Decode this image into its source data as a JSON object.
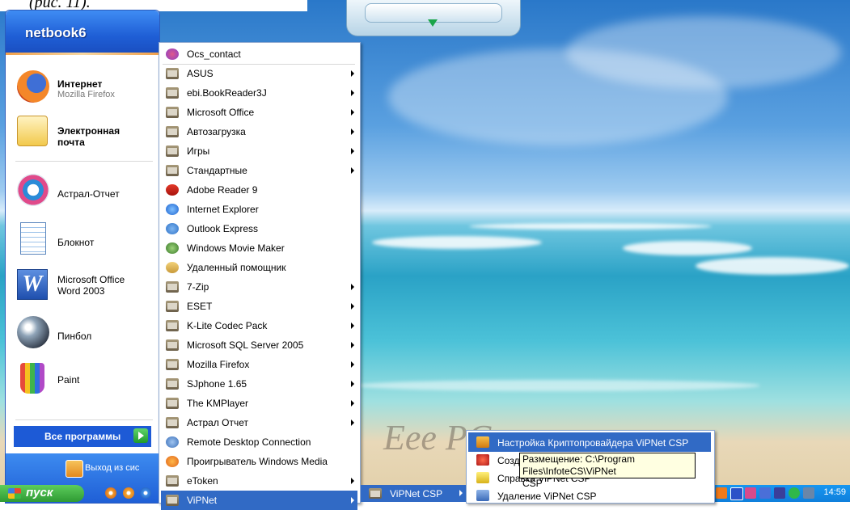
{
  "desktop": {
    "caption": "(рис. 11).",
    "wallpaper_logo": "Eee PC"
  },
  "start_menu": {
    "user": "netbook6",
    "pinned": [
      {
        "title": "Интернет",
        "subtitle": "Mozilla Firefox",
        "icon": "firefox-icon"
      },
      {
        "title": "Электронная",
        "subtitle": "почта",
        "icon": "email-icon"
      }
    ],
    "recent": [
      {
        "title": "Астрал-Отчет",
        "icon": "astral-icon"
      },
      {
        "title": "Блокнот",
        "icon": "notepad-icon"
      },
      {
        "title": "Microsoft Office",
        "subtitle": "Word 2003",
        "icon": "word-icon"
      },
      {
        "title": "Пинбол",
        "icon": "pinball-icon"
      },
      {
        "title": "Paint",
        "icon": "paint-icon"
      }
    ],
    "all_programs": "Все программы",
    "logoff": "Выход из сис"
  },
  "taskbar": {
    "start_label": "пуск",
    "clock": "14:59"
  },
  "programs_menu": {
    "items": [
      {
        "label": "Ocs_contact",
        "icon": "contact-icon",
        "submenu": false
      },
      {
        "label": "ASUS",
        "icon": "folder-icon",
        "submenu": true
      },
      {
        "label": "ebi.BookReader3J",
        "icon": "folder-icon",
        "submenu": true
      },
      {
        "label": "Microsoft Office",
        "icon": "folder-icon",
        "submenu": true
      },
      {
        "label": "Автозагрузка",
        "icon": "folder-icon",
        "submenu": true
      },
      {
        "label": "Игры",
        "icon": "folder-icon",
        "submenu": true
      },
      {
        "label": "Стандартные",
        "icon": "folder-icon",
        "submenu": true
      },
      {
        "label": "Adobe Reader 9",
        "icon": "adobe-reader-icon",
        "submenu": false
      },
      {
        "label": "Internet Explorer",
        "icon": "ie-icon",
        "submenu": false
      },
      {
        "label": "Outlook Express",
        "icon": "outlook-icon",
        "submenu": false
      },
      {
        "label": "Windows Movie Maker",
        "icon": "movie-maker-icon",
        "submenu": false
      },
      {
        "label": "Удаленный помощник",
        "icon": "remote-assistant-icon",
        "submenu": false
      },
      {
        "label": "7-Zip",
        "icon": "folder-icon",
        "submenu": true
      },
      {
        "label": "ESET",
        "icon": "folder-icon",
        "submenu": true
      },
      {
        "label": "K-Lite Codec Pack",
        "icon": "folder-icon",
        "submenu": true
      },
      {
        "label": "Microsoft SQL Server 2005",
        "icon": "folder-icon",
        "submenu": true
      },
      {
        "label": "Mozilla Firefox",
        "icon": "folder-icon",
        "submenu": true
      },
      {
        "label": "SJphone 1.65",
        "icon": "folder-icon",
        "submenu": true
      },
      {
        "label": "The KMPlayer",
        "icon": "folder-icon",
        "submenu": true
      },
      {
        "label": "Астрал Отчет",
        "icon": "folder-icon",
        "submenu": true
      },
      {
        "label": "Remote Desktop Connection",
        "icon": "rdp-icon",
        "submenu": false
      },
      {
        "label": "Проигрыватель Windows Media",
        "icon": "media-player-icon",
        "submenu": false
      },
      {
        "label": "eToken",
        "icon": "folder-icon",
        "submenu": true
      },
      {
        "label": "ViPNet",
        "icon": "folder-icon",
        "submenu": true,
        "active": true
      }
    ]
  },
  "vipnet_menu": {
    "label": "ViPNet CSP"
  },
  "csp_menu": {
    "items": [
      {
        "label": "Настройка Криптопровайдера ViPNet CSP",
        "icon": "settings-icon",
        "active": true
      },
      {
        "label": "Созд",
        "icon": "create-icon"
      },
      {
        "label": "Справка ViPNet CSP",
        "icon": "help-icon"
      },
      {
        "label": "Удаление ViPNet CSP",
        "icon": "uninstall-icon"
      }
    ]
  },
  "tooltip": {
    "line1": "Размещение: C:\\Program Files\\InfoteCS\\ViPNet",
    "line2": "CSP"
  }
}
